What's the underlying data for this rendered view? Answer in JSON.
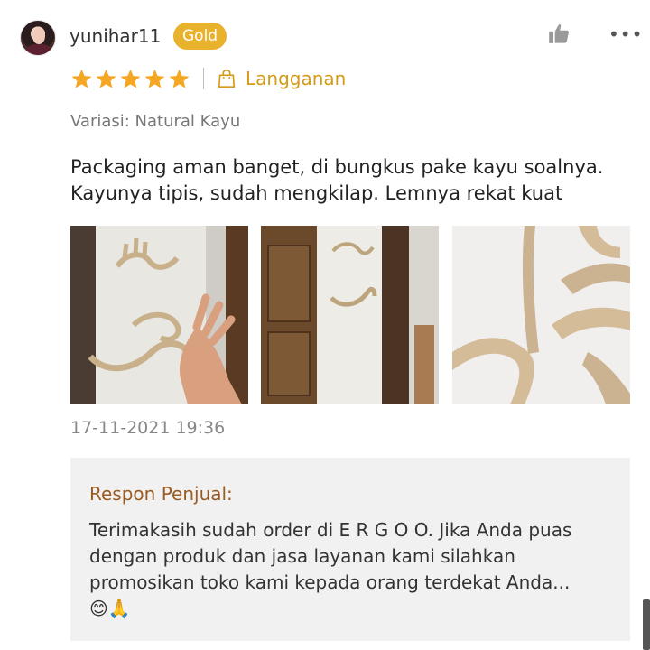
{
  "reviewer": {
    "name": "yunihar11",
    "badge": "Gold"
  },
  "rating": {
    "stars": 5,
    "max": 5,
    "tag": "Langganan"
  },
  "variation": "Variasi: Natural Kayu",
  "review_text": "Packaging aman banget, di bungkus pake kayu soalnya. Kayunya tipis, sudah mengkilap. Lemnya rekat kuat",
  "photos": [
    {
      "icon": "wooden-calligraphy-photo-hand"
    },
    {
      "icon": "wooden-calligraphy-photo-door"
    },
    {
      "icon": "wooden-calligraphy-photo-closeup"
    }
  ],
  "timestamp": "17-11-2021 19:36",
  "seller_response": {
    "title": "Respon Penjual:",
    "text": "Terimakasih sudah order di E R G O O. Jika Anda puas dengan produk dan jasa layanan kami silahkan promosikan toko kami kepada orang terdekat Anda...",
    "emojis": "😊🙏"
  },
  "colors": {
    "gold_badge": "#e8b22d",
    "star": "#f5a623",
    "subscription": "#d49b16",
    "response_title": "#9a5b22",
    "response_bg": "#f1f1f1"
  },
  "icons": {
    "like": "thumbs-up-icon",
    "more": "more-dots-icon",
    "bag": "shopping-bag-icon"
  },
  "more_label": "•••"
}
